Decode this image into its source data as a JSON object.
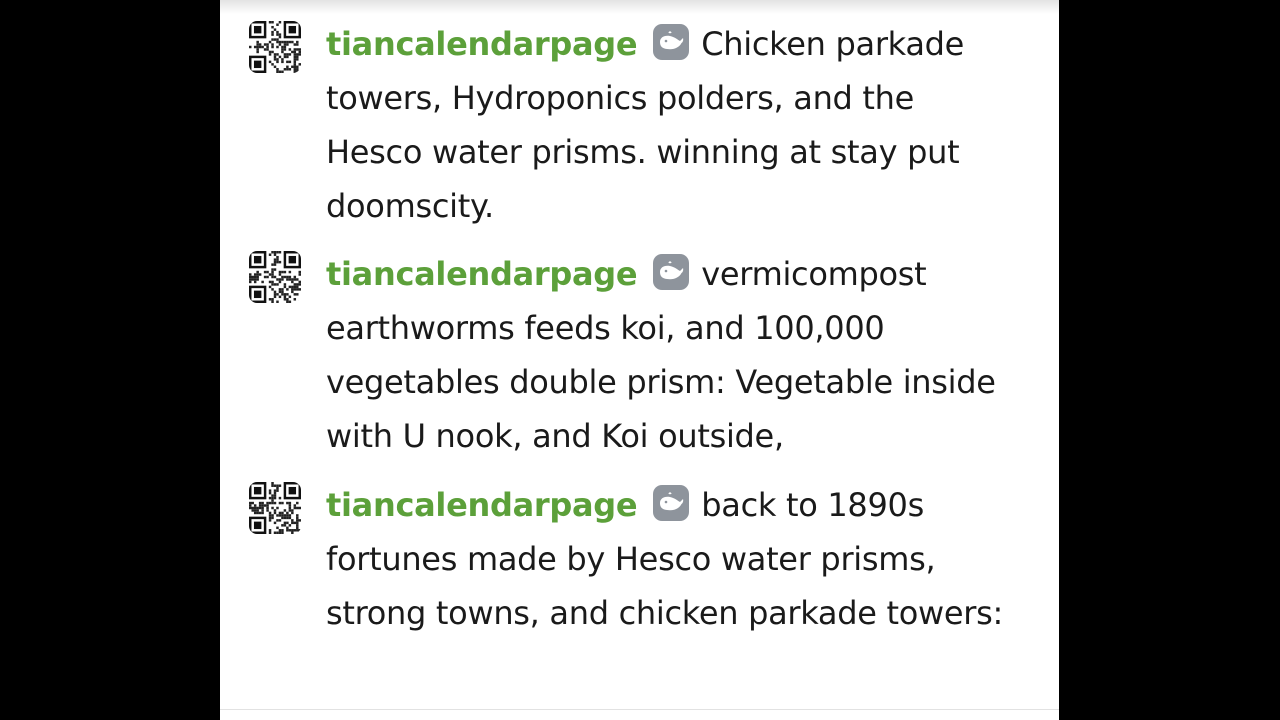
{
  "chat": {
    "messages": [
      {
        "username": "tiancalendarpage",
        "badge_icon": "whale-icon",
        "text": "Chicken parkade towers, Hydroponics polders, and the Hesco water prisms. winning at stay put doomscity."
      },
      {
        "username": "tiancalendarpage",
        "badge_icon": "whale-icon",
        "text": "vermicompost earthworms feeds koi, and 100,000 vegetables double prism: Vegetable inside with U nook, and Koi outside,"
      },
      {
        "username": "tiancalendarpage",
        "badge_icon": "whale-icon",
        "text": "back to 1890s fortunes made by Hesco water prisms, strong towns, and chicken parkade towers:"
      }
    ]
  },
  "colors": {
    "username": "#5ca03a",
    "text": "#1a1a1a",
    "badge": "#8e949c",
    "panel": "#ffffff",
    "letterbox": "#000000"
  }
}
